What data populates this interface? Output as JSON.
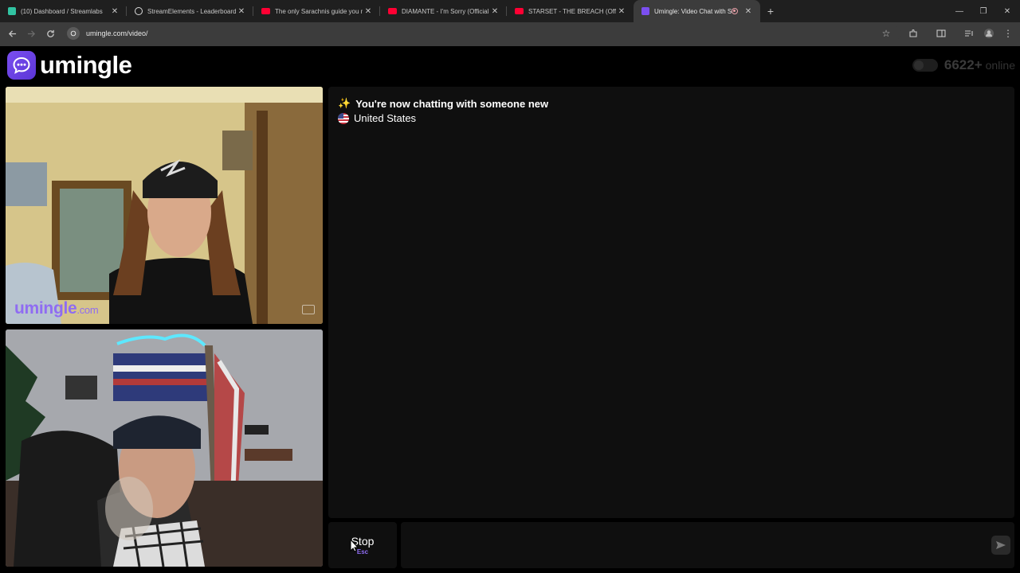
{
  "browser": {
    "tabs": [
      {
        "title": "(10) Dashboard / Streamlabs",
        "icon": "streamlabs-icon",
        "color": "#31c3a2"
      },
      {
        "title": "StreamElements - Leaderboard",
        "icon": "streamelements-icon",
        "color": "#ffffff"
      },
      {
        "title": "The only Sarachnis guide you n",
        "icon": "youtube-icon",
        "color": "#ff0033"
      },
      {
        "title": "DIAMANTE - I'm Sorry (Official",
        "icon": "youtube-icon",
        "color": "#ff0033"
      },
      {
        "title": "STARSET - THE BREACH (Officia",
        "icon": "youtube-icon",
        "color": "#ff0033"
      },
      {
        "title": "Umingle: Video Chat with S",
        "icon": "umingle-icon",
        "color": "#7b4ff0",
        "active": true
      }
    ],
    "url": "umingle.com/video/"
  },
  "header": {
    "brand": "umingle",
    "online_count": "6622+",
    "online_label": "online"
  },
  "video": {
    "watermark_main": "umingle",
    "watermark_suffix": ".com"
  },
  "chat": {
    "status_message": "You're now chatting with someone new",
    "country": "United States"
  },
  "controls": {
    "stop_label": "Stop",
    "stop_shortcut": "Esc",
    "message_placeholder": ""
  },
  "colors": {
    "accent": "#8f6cf2",
    "background": "#000000",
    "panel": "#0f0f0f"
  }
}
